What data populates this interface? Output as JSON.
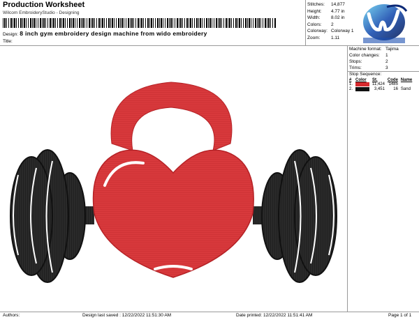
{
  "header": {
    "title": "Production Worksheet",
    "subtitle": "Wilcom EmbroideryStudio - Designing",
    "design_label": "Design:",
    "design_value": "8 inch gym embroidery design machine from wido embroidery",
    "title_label": "Title:"
  },
  "stats": [
    {
      "key": "Stitches:",
      "value": "14,877"
    },
    {
      "key": "Height:",
      "value": "4.77 in"
    },
    {
      "key": "Width:",
      "value": "8.02 in"
    },
    {
      "key": "Colors:",
      "value": "2"
    },
    {
      "key": "Colorway:",
      "value": "Colorway 1"
    },
    {
      "key": "Zoom:",
      "value": "1.11"
    }
  ],
  "machine": [
    {
      "key": "Machine format:",
      "value": "Tajima"
    },
    {
      "key": "Color changes:",
      "value": "1"
    },
    {
      "key": "Stops:",
      "value": "2"
    },
    {
      "key": "Trims:",
      "value": "3"
    }
  ],
  "stop_sequence": {
    "heading": "Stop Sequence:",
    "columns": [
      "#",
      "Color",
      "St.",
      "Code",
      "Name"
    ],
    "rows": [
      {
        "num": "1.",
        "color": "#d62a2e",
        "stitches": "11,424",
        "code": "1485",
        "name": ""
      },
      {
        "num": "2.",
        "color": "#111111",
        "stitches": "3,451",
        "code": "16",
        "name": "Sand"
      }
    ]
  },
  "footer": {
    "authors": "Authors:",
    "saved": "Design last saved : 12/22/2022 11:51:30 AM",
    "printed": "Date printed: 12/22/2022 11:51:41 AM",
    "page": "Page 1 of 1"
  },
  "colors": {
    "thread_red": "#d62a2e",
    "thread_black": "#1a1a1a"
  }
}
